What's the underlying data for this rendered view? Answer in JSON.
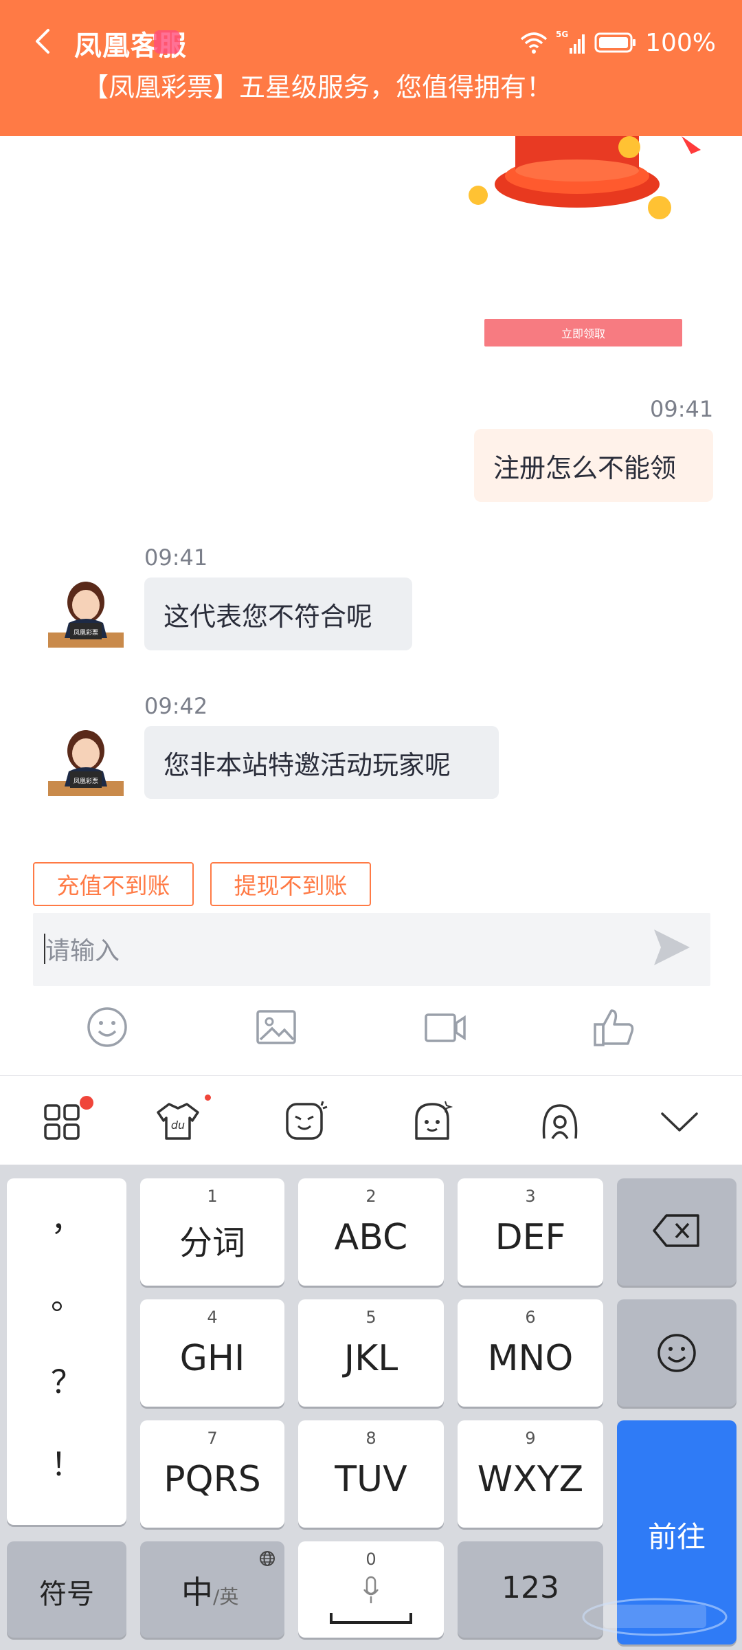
{
  "status_bar": {
    "battery": "100%"
  },
  "header": {
    "title": "凤凰客服",
    "subtitle": "【凤凰彩票】五星级服务，您值得拥有！"
  },
  "promo": {
    "button_label": "立即领取"
  },
  "messages": [
    {
      "sender": "me",
      "time": "09:41",
      "text": "注册怎么不能领"
    },
    {
      "sender": "agent",
      "time": "09:41",
      "text": "这代表您不符合呢"
    },
    {
      "sender": "agent",
      "time": "09:42",
      "text": "您非本站特邀活动玩家呢"
    }
  ],
  "avatar_label": "凤凰彩票",
  "quick_replies": [
    "充值不到账",
    "提现不到账"
  ],
  "input": {
    "placeholder": "请输入"
  },
  "keyboard": {
    "punctuation": [
      "，",
      "。",
      "？",
      "！"
    ],
    "keys": [
      {
        "num": "1",
        "label": "分词"
      },
      {
        "num": "2",
        "label": "ABC"
      },
      {
        "num": "3",
        "label": "DEF"
      },
      {
        "num": "4",
        "label": "GHI"
      },
      {
        "num": "5",
        "label": "JKL"
      },
      {
        "num": "6",
        "label": "MNO"
      },
      {
        "num": "7",
        "label": "PQRS"
      },
      {
        "num": "8",
        "label": "TUV"
      },
      {
        "num": "9",
        "label": "WXYZ"
      }
    ],
    "symbols_label": "符号",
    "lang_main": "中",
    "lang_alt": "/英",
    "space_num": "0",
    "numbers_label": "123",
    "go_label": "前往"
  },
  "colors": {
    "header": "#ff7a45",
    "go_key": "#2f7bf6"
  }
}
